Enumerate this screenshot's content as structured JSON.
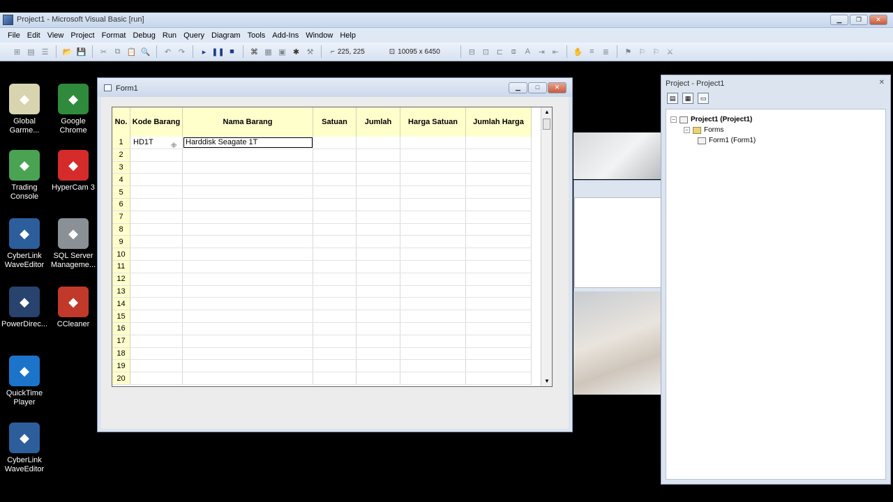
{
  "ide": {
    "title": "Project1 - Microsoft Visual Basic [run]",
    "menus": [
      "File",
      "Edit",
      "View",
      "Project",
      "Format",
      "Debug",
      "Run",
      "Query",
      "Diagram",
      "Tools",
      "Add-Ins",
      "Window",
      "Help"
    ],
    "position_readout": "225, 225",
    "size_readout": "10095 x 6450"
  },
  "desktop_icons": [
    {
      "label": "Global Garme...",
      "icon": "globalgarment-icon",
      "color": "#d9d4b0"
    },
    {
      "label": "Google Chrome",
      "icon": "chrome-icon",
      "color": "#2f8a3b"
    },
    {
      "label": "Trading Console",
      "icon": "trading-icon",
      "color": "#4aa352"
    },
    {
      "label": "HyperCam 3",
      "icon": "hypercam-icon",
      "color": "#d52b2b"
    },
    {
      "label": "CyberLink WaveEditor",
      "icon": "waveeditor-icon",
      "color": "#2c5e9c"
    },
    {
      "label": "SQL Server Manageme...",
      "icon": "sqlserver-icon",
      "color": "#8b8f96"
    },
    {
      "label": "PowerDirec...",
      "icon": "powerdirector-icon",
      "color": "#27436e"
    },
    {
      "label": "CCleaner",
      "icon": "ccleaner-icon",
      "color": "#c0392b"
    },
    {
      "label": "QuickTime Player",
      "icon": "quicktime-icon",
      "color": "#1b74c9"
    },
    {
      "label": "CyberLink WaveEditor",
      "icon": "waveeditor-icon",
      "color": "#2c5e9c"
    }
  ],
  "form": {
    "title": "Form1",
    "grid": {
      "columns": [
        "No.",
        "Kode Barang",
        "Nama Barang",
        "Satuan",
        "Jumlah",
        "Harga Satuan",
        "Jumlah Harga"
      ],
      "rows": [
        [
          "1",
          "HD1T",
          "Harddisk Seagate 1T",
          "",
          "",
          "",
          ""
        ],
        [
          "2",
          "",
          "",
          "",
          "",
          "",
          ""
        ],
        [
          "3",
          "",
          "",
          "",
          "",
          "",
          ""
        ],
        [
          "4",
          "",
          "",
          "",
          "",
          "",
          ""
        ],
        [
          "5",
          "",
          "",
          "",
          "",
          "",
          ""
        ],
        [
          "6",
          "",
          "",
          "",
          "",
          "",
          ""
        ],
        [
          "7",
          "",
          "",
          "",
          "",
          "",
          ""
        ],
        [
          "8",
          "",
          "",
          "",
          "",
          "",
          ""
        ],
        [
          "9",
          "",
          "",
          "",
          "",
          "",
          ""
        ],
        [
          "10",
          "",
          "",
          "",
          "",
          "",
          ""
        ],
        [
          "11",
          "",
          "",
          "",
          "",
          "",
          ""
        ],
        [
          "12",
          "",
          "",
          "",
          "",
          "",
          ""
        ],
        [
          "13",
          "",
          "",
          "",
          "",
          "",
          ""
        ],
        [
          "14",
          "",
          "",
          "",
          "",
          "",
          ""
        ],
        [
          "15",
          "",
          "",
          "",
          "",
          "",
          ""
        ],
        [
          "16",
          "",
          "",
          "",
          "",
          "",
          ""
        ],
        [
          "17",
          "",
          "",
          "",
          "",
          "",
          ""
        ],
        [
          "18",
          "",
          "",
          "",
          "",
          "",
          ""
        ],
        [
          "19",
          "",
          "",
          "",
          "",
          "",
          ""
        ],
        [
          "20",
          "",
          "",
          "",
          "",
          "",
          ""
        ]
      ]
    }
  },
  "project_explorer": {
    "title": "Project - Project1",
    "tree": [
      {
        "label": "Project1 (Project1)",
        "bold": true,
        "level": 0,
        "box": "-",
        "icon": "project-icon"
      },
      {
        "label": "Forms",
        "bold": false,
        "level": 1,
        "box": "-",
        "icon": "folder-icon"
      },
      {
        "label": "Form1 (Form1)",
        "bold": false,
        "level": 2,
        "box": "",
        "icon": "form-icon"
      }
    ]
  }
}
